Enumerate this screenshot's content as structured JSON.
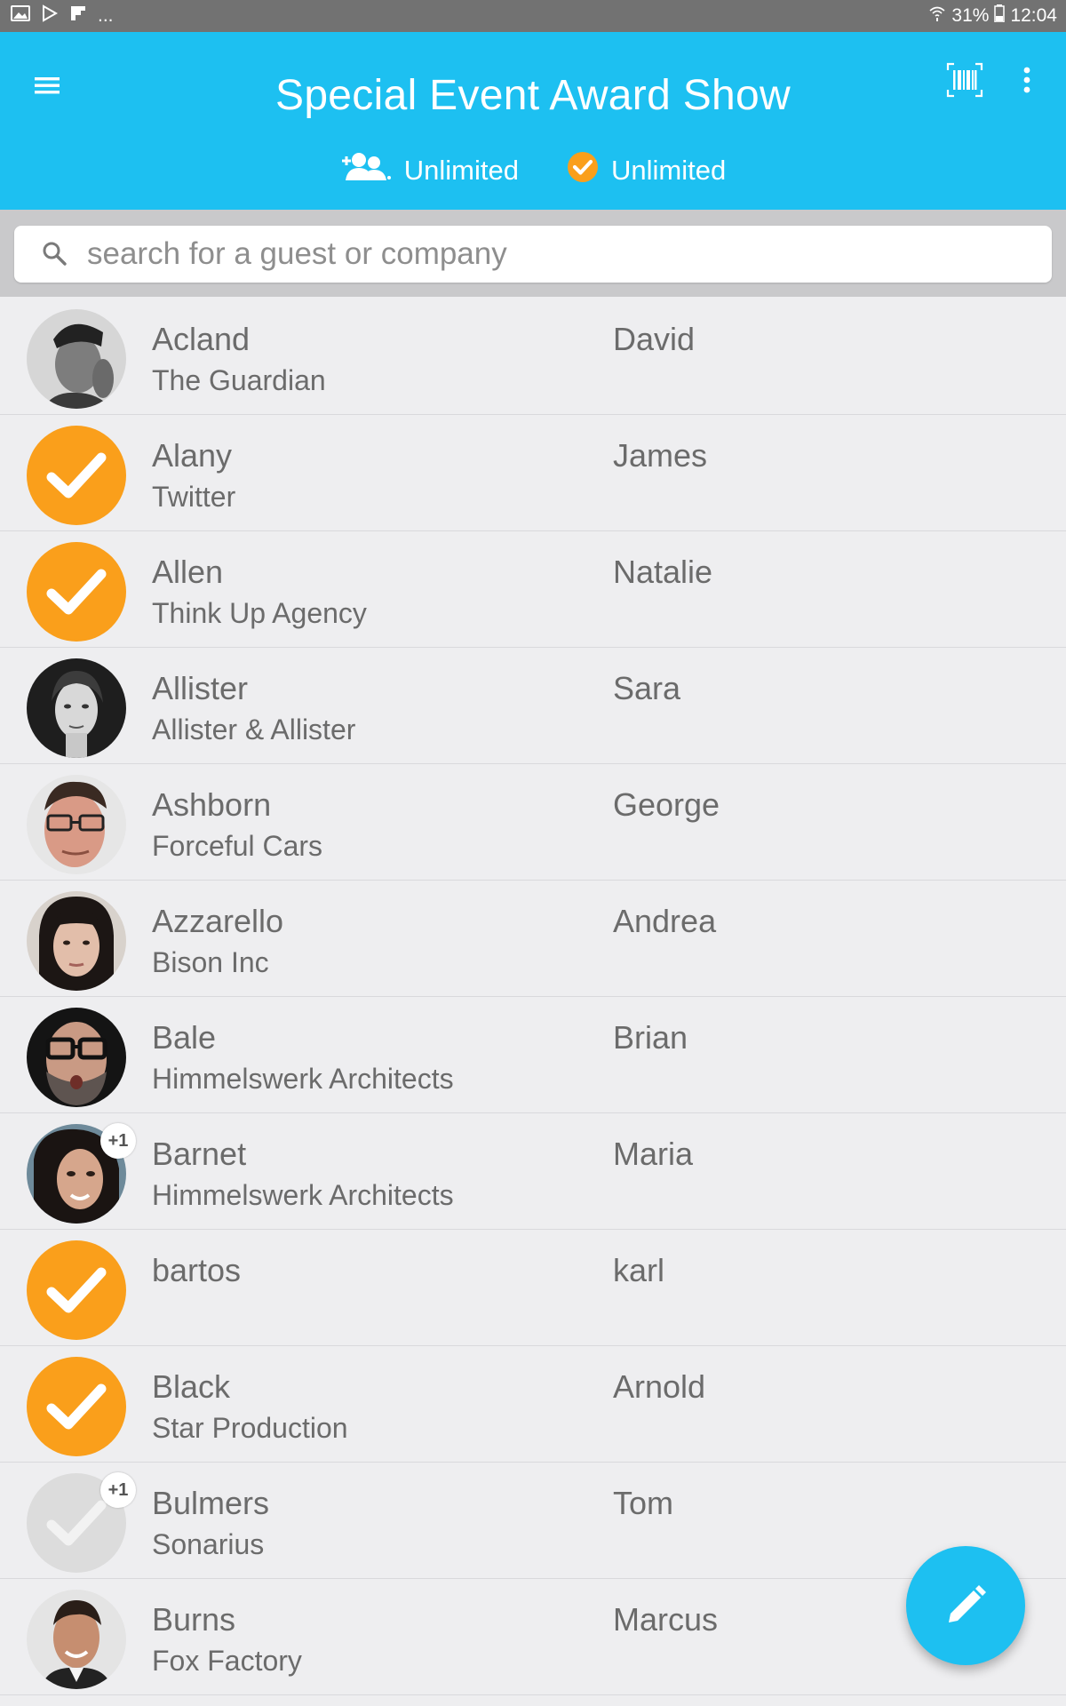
{
  "status_bar": {
    "battery": "31%",
    "time": "12:04",
    "dots": "..."
  },
  "header": {
    "title": "Special Event Award Show",
    "accent_color": "#1dc0f1",
    "stats": [
      {
        "icon": "guests-icon",
        "label": "Unlimited"
      },
      {
        "icon": "checked-in-icon",
        "label": "Unlimited"
      }
    ]
  },
  "search": {
    "placeholder": "search for a guest or company",
    "value": ""
  },
  "guests": [
    {
      "last": "Acland",
      "company": "The Guardian",
      "first": "David",
      "avatar": "photo",
      "plus_one": ""
    },
    {
      "last": "Alany",
      "company": "Twitter",
      "first": "James",
      "avatar": "checked",
      "plus_one": ""
    },
    {
      "last": "Allen",
      "company": "Think Up Agency",
      "first": "Natalie",
      "avatar": "checked",
      "plus_one": ""
    },
    {
      "last": "Allister",
      "company": "Allister & Allister",
      "first": "Sara",
      "avatar": "photo",
      "plus_one": ""
    },
    {
      "last": "Ashborn",
      "company": "Forceful Cars",
      "first": "George",
      "avatar": "photo",
      "plus_one": ""
    },
    {
      "last": "Azzarello",
      "company": "Bison Inc",
      "first": "Andrea",
      "avatar": "photo",
      "plus_one": ""
    },
    {
      "last": "Bale",
      "company": "Himmelswerk Architects",
      "first": "Brian",
      "avatar": "photo",
      "plus_one": ""
    },
    {
      "last": "Barnet",
      "company": "Himmelswerk Architects",
      "first": "Maria",
      "avatar": "photo",
      "plus_one": "+1"
    },
    {
      "last": "bartos",
      "company": "",
      "first": "karl",
      "avatar": "checked",
      "plus_one": ""
    },
    {
      "last": "Black",
      "company": "Star Production",
      "first": "Arnold",
      "avatar": "checked",
      "plus_one": ""
    },
    {
      "last": "Bulmers",
      "company": "Sonarius",
      "first": "Tom",
      "avatar": "unchecked",
      "plus_one": "+1"
    },
    {
      "last": "Burns",
      "company": "Fox Factory",
      "first": "Marcus",
      "avatar": "photo",
      "plus_one": ""
    }
  ],
  "fab": {
    "icon": "pencil-icon"
  },
  "colors": {
    "checked": "#fa9f1b",
    "unchecked": "#dcdcdc",
    "text": "#6b6b6b"
  }
}
